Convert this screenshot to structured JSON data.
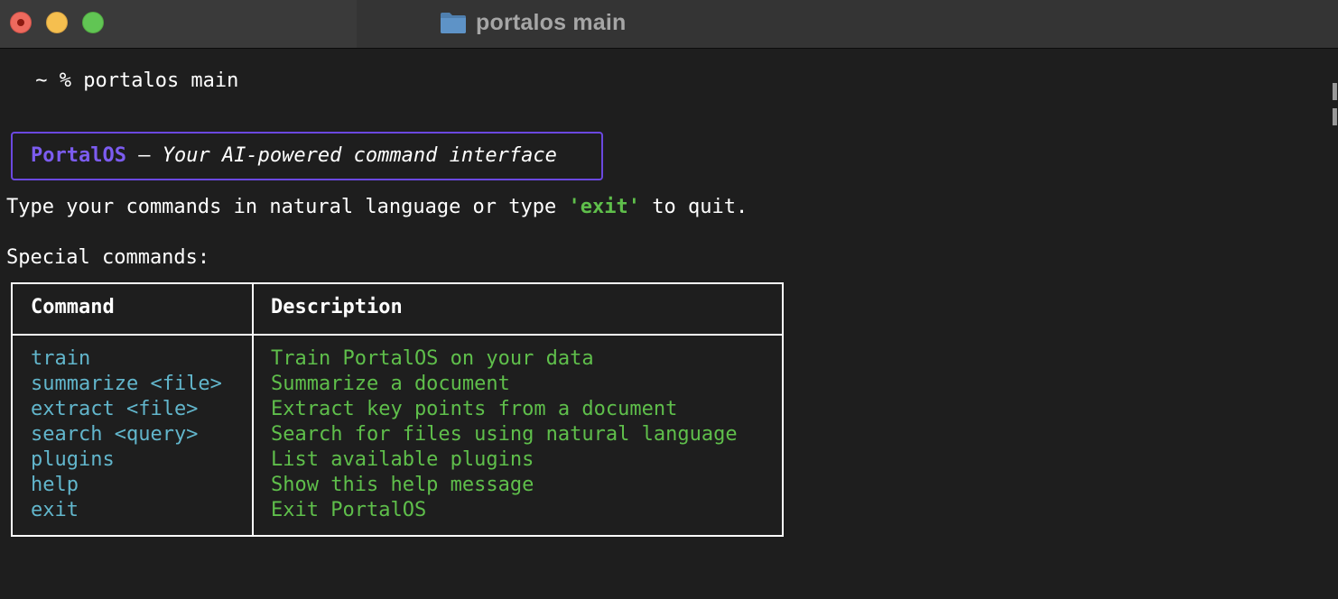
{
  "window": {
    "title": "portalos main",
    "title_icon": "folder-icon"
  },
  "terminal": {
    "prompt_line": " ~ % portalos main",
    "banner": {
      "brand": "PortalOS",
      "separator": " — ",
      "tagline": "Your AI-powered command interface"
    },
    "instruction": {
      "before": "Type your commands in natural language or type ",
      "keyword": "'exit'",
      "after": " to quit."
    },
    "special_heading": "Special commands:",
    "table": {
      "headers": [
        "Command",
        "Description"
      ],
      "rows": [
        {
          "command": "train",
          "description": "Train PortalOS on your data"
        },
        {
          "command": "summarize <file>",
          "description": "Summarize a document"
        },
        {
          "command": "extract <file>",
          "description": "Extract key points from a document"
        },
        {
          "command": "search <query>",
          "description": "Search for files using natural language"
        },
        {
          "command": "plugins",
          "description": "List available plugins"
        },
        {
          "command": "help",
          "description": "Show this help message"
        },
        {
          "command": "exit",
          "description": "Exit PortalOS"
        }
      ]
    }
  },
  "colors": {
    "background": "#1e1e1e",
    "titlebar": "#343434",
    "brand_purple": "#7c5cf0",
    "border_purple": "#6b48e0",
    "command_cyan": "#62b6cc",
    "description_green": "#5fbf4b"
  }
}
